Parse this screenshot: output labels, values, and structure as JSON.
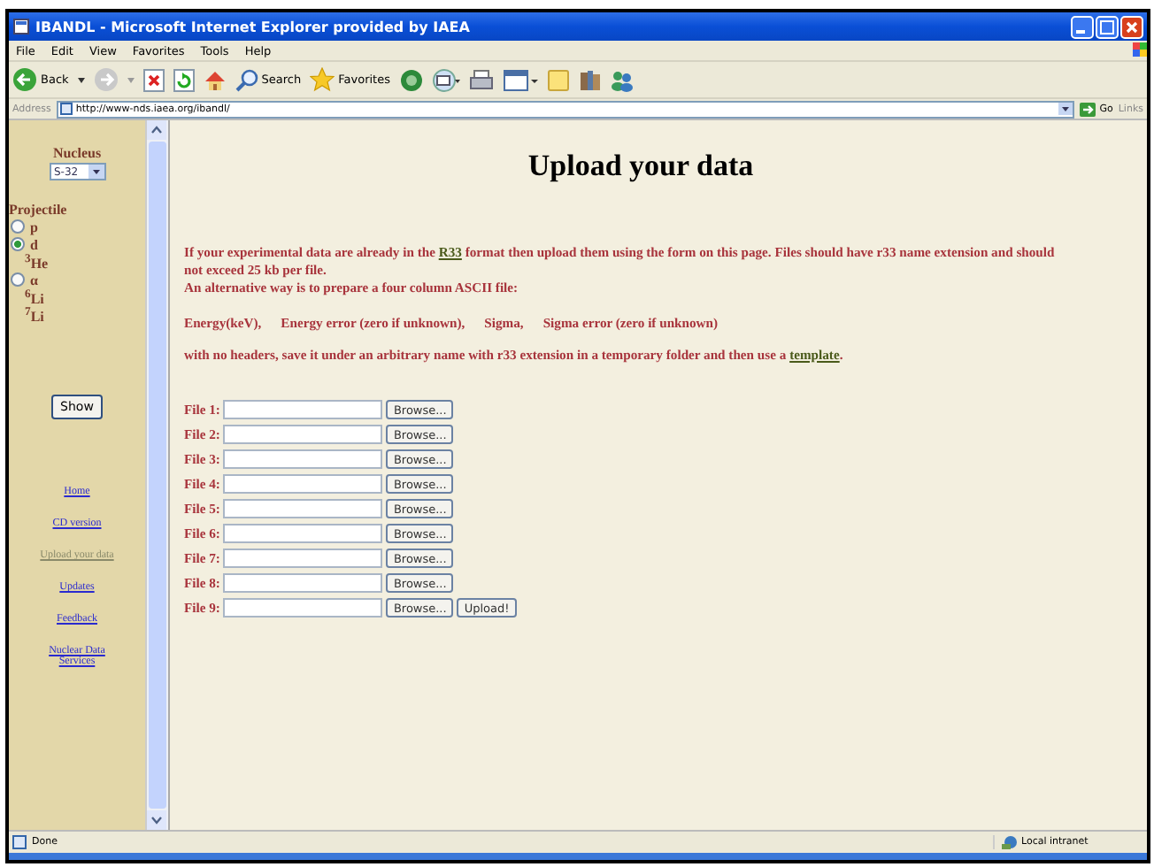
{
  "window": {
    "title": "IBANDL - Microsoft Internet Explorer provided by IAEA"
  },
  "menu": [
    "File",
    "Edit",
    "View",
    "Favorites",
    "Tools",
    "Help"
  ],
  "toolbar": {
    "back": "Back",
    "search": "Search",
    "favorites": "Favorites"
  },
  "address": {
    "label": "Address",
    "url": "http://www-nds.iaea.org/ibandl/",
    "go": "Go",
    "links": "Links"
  },
  "sidebar": {
    "nucleus_label": "Nucleus",
    "nucleus": "S-32",
    "projectile_label": "Projectile",
    "projectiles": [
      {
        "kind": "radio",
        "label": "p",
        "selected": false
      },
      {
        "kind": "radio",
        "label": "d",
        "selected": true
      },
      {
        "kind": "text",
        "label": "$^{3}$He"
      },
      {
        "kind": "radio",
        "label": "α",
        "selected": false
      },
      {
        "kind": "text",
        "label": "$^{6}$Li"
      },
      {
        "kind": "text",
        "label": "$^{7}$Li"
      }
    ],
    "show": "Show",
    "links": [
      {
        "label": "Home",
        "current": false
      },
      {
        "label": "CD version",
        "current": false
      },
      {
        "label": "Upload your data",
        "current": true
      },
      {
        "label": "Updates",
        "current": false
      },
      {
        "label": "Feedback",
        "current": false
      },
      {
        "label": "Nuclear Data Services",
        "current": false
      }
    ]
  },
  "main": {
    "heading": "Upload your data",
    "intro": [
      {
        "kind": "text",
        "text": "If your experimental data are already in the "
      },
      {
        "kind": "link",
        "text": "R33"
      },
      {
        "kind": "text",
        "text": " format then upload them using the form on this page. Files should have r33 name extension and should not exceed 25 kb per file."
      }
    ],
    "alternative": "An alternative way is to prepare a four column ASCII file:",
    "columns": [
      "Energy(keV),",
      "Energy error (zero if unknown),",
      "Sigma,",
      "Sigma error (zero if unknown)"
    ],
    "instructions": [
      {
        "kind": "text",
        "text": "with no headers, save it under an arbitrary name with r33 extension in a temporary folder and then use a "
      },
      {
        "kind": "link",
        "text": "template"
      },
      {
        "kind": "text",
        "text": "."
      }
    ],
    "files": [
      {
        "label": "File 1:",
        "browse": "Browse..."
      },
      {
        "label": "File 2:",
        "browse": "Browse..."
      },
      {
        "label": "File 3:",
        "browse": "Browse..."
      },
      {
        "label": "File 4:",
        "browse": "Browse..."
      },
      {
        "label": "File 5:",
        "browse": "Browse..."
      },
      {
        "label": "File 6:",
        "browse": "Browse..."
      },
      {
        "label": "File 7:",
        "browse": "Browse..."
      },
      {
        "label": "File 8:",
        "browse": "Browse..."
      },
      {
        "label": "File 9:",
        "browse": "Browse...",
        "upload": "Upload!"
      }
    ]
  },
  "status": {
    "text": "Done",
    "zone": "Local intranet"
  }
}
